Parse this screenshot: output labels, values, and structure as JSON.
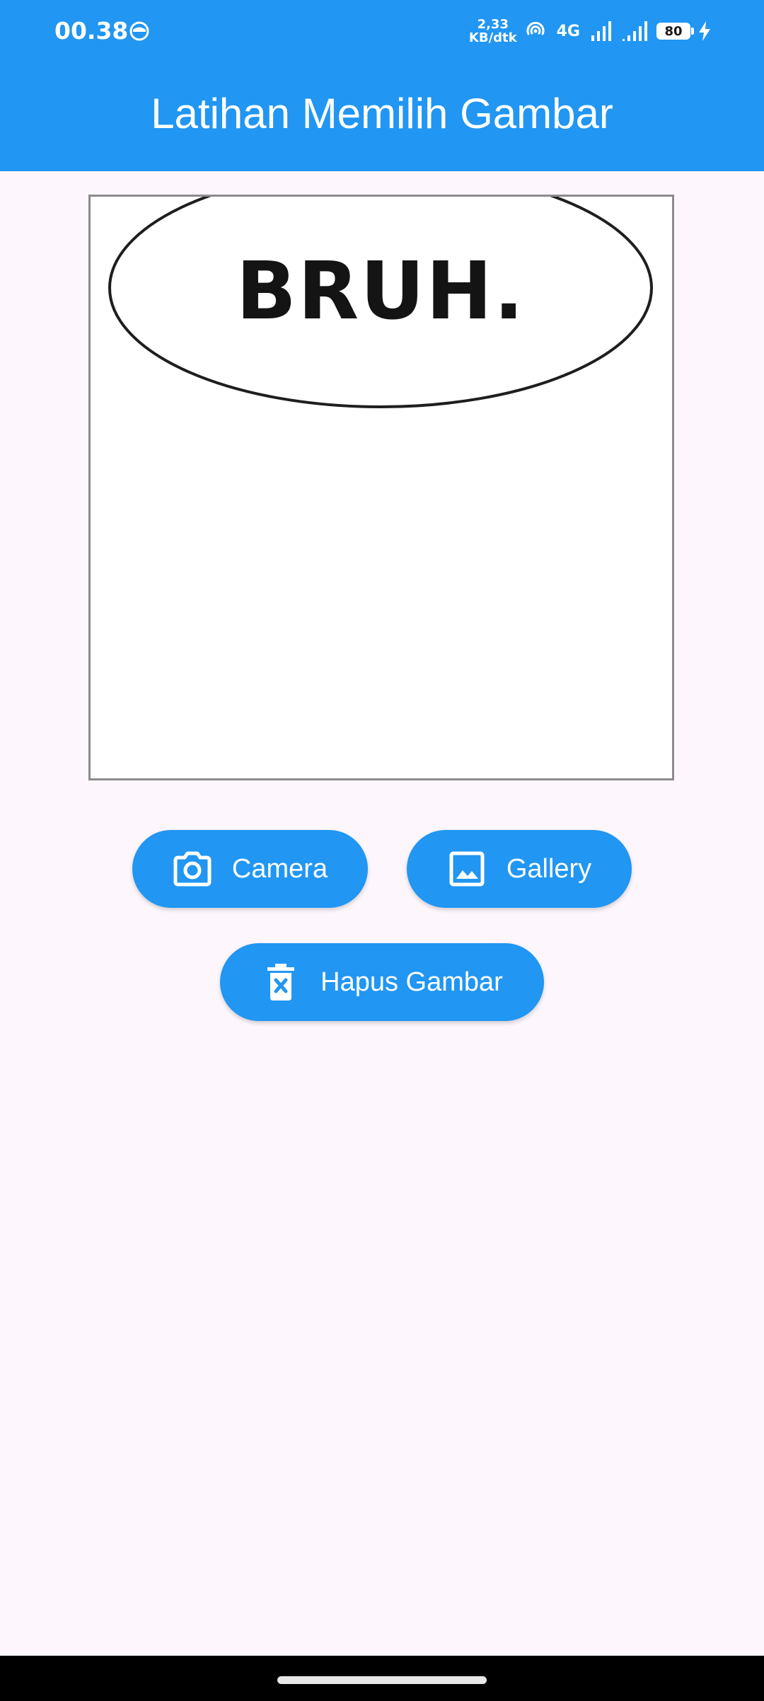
{
  "status_bar": {
    "time": "00.38",
    "net_speed_value": "2,33",
    "net_speed_unit": "KB/dtk",
    "network_type": "4G",
    "battery_level": "80"
  },
  "app_bar": {
    "title": "Latihan Memilih Gambar"
  },
  "image_preview": {
    "caption_text": "BRUH."
  },
  "buttons": {
    "camera_label": "Camera",
    "gallery_label": "Gallery",
    "delete_label": "Hapus Gambar"
  },
  "colors": {
    "primary": "#2196f3",
    "background": "#fdf7fd"
  }
}
